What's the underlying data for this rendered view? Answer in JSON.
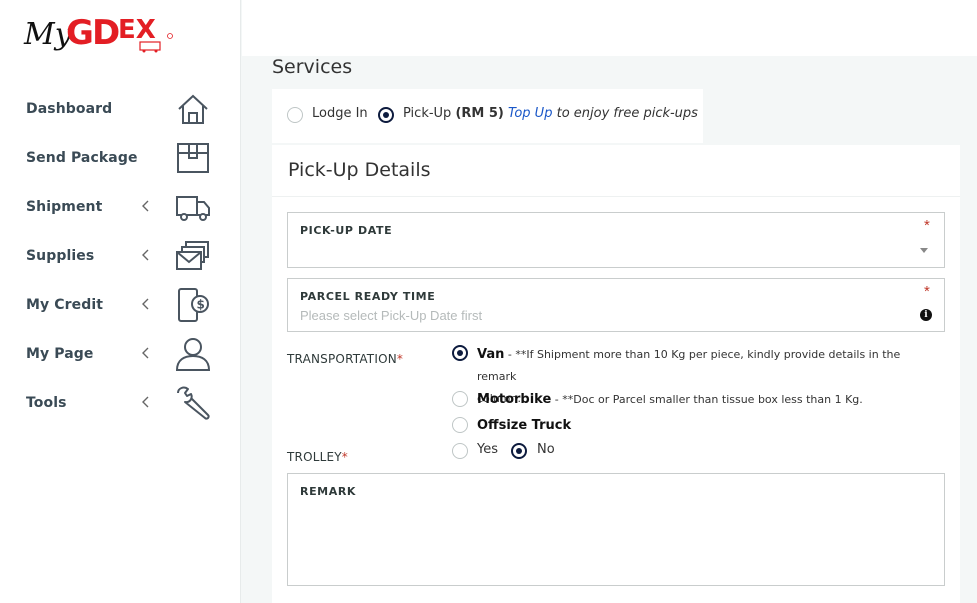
{
  "brand": {
    "logo_text_my": "My",
    "logo_text_gdex": "GDEX",
    "primary_color": "#e31e24",
    "accent_color": "#0d1b3e"
  },
  "sidebar": {
    "items": [
      {
        "label": "Dashboard",
        "icon": "home-icon",
        "has_submenu": false
      },
      {
        "label": "Send Package",
        "icon": "package-icon",
        "has_submenu": false
      },
      {
        "label": "Shipment",
        "icon": "truck-icon",
        "has_submenu": true
      },
      {
        "label": "Supplies",
        "icon": "envelopes-icon",
        "has_submenu": true
      },
      {
        "label": "My Credit",
        "icon": "wallet-dollar-icon",
        "has_submenu": true
      },
      {
        "label": "My Page",
        "icon": "user-icon",
        "has_submenu": true
      },
      {
        "label": "Tools",
        "icon": "wrench-icon",
        "has_submenu": true
      }
    ]
  },
  "services": {
    "title": "Services",
    "options": [
      {
        "label": "Lodge In",
        "selected": false
      },
      {
        "label": "Pick-Up",
        "price": "(RM 5)",
        "selected": true
      }
    ],
    "topup_link": "Top Up",
    "topup_text": "to enjoy free pick-ups"
  },
  "pickup": {
    "title": "Pick-Up Details",
    "pickup_date": {
      "label": "PICK-UP DATE",
      "required": "*",
      "value": ""
    },
    "parcel_ready_time": {
      "label": "PARCEL READY TIME",
      "required": "*",
      "placeholder": "Please select Pick-Up Date first"
    },
    "transportation": {
      "label": "TRANSPORTATION",
      "required": "*",
      "options": [
        {
          "title": "Van",
          "desc": " - **If Shipment more than 10 Kg per piece, kindly provide details in the remark",
          "desc2": "column.",
          "selected": true
        },
        {
          "title": "Motorbike",
          "desc": " - **Doc or Parcel smaller than tissue box less than 1 Kg.",
          "selected": false
        },
        {
          "title": "Offsize Truck",
          "desc": "",
          "selected": false
        }
      ]
    },
    "trolley": {
      "label": "TROLLEY",
      "required": "*",
      "options": [
        {
          "label": "Yes",
          "selected": false
        },
        {
          "label": "No",
          "selected": true
        }
      ]
    },
    "remark": {
      "label": "REMARK",
      "value": ""
    }
  }
}
